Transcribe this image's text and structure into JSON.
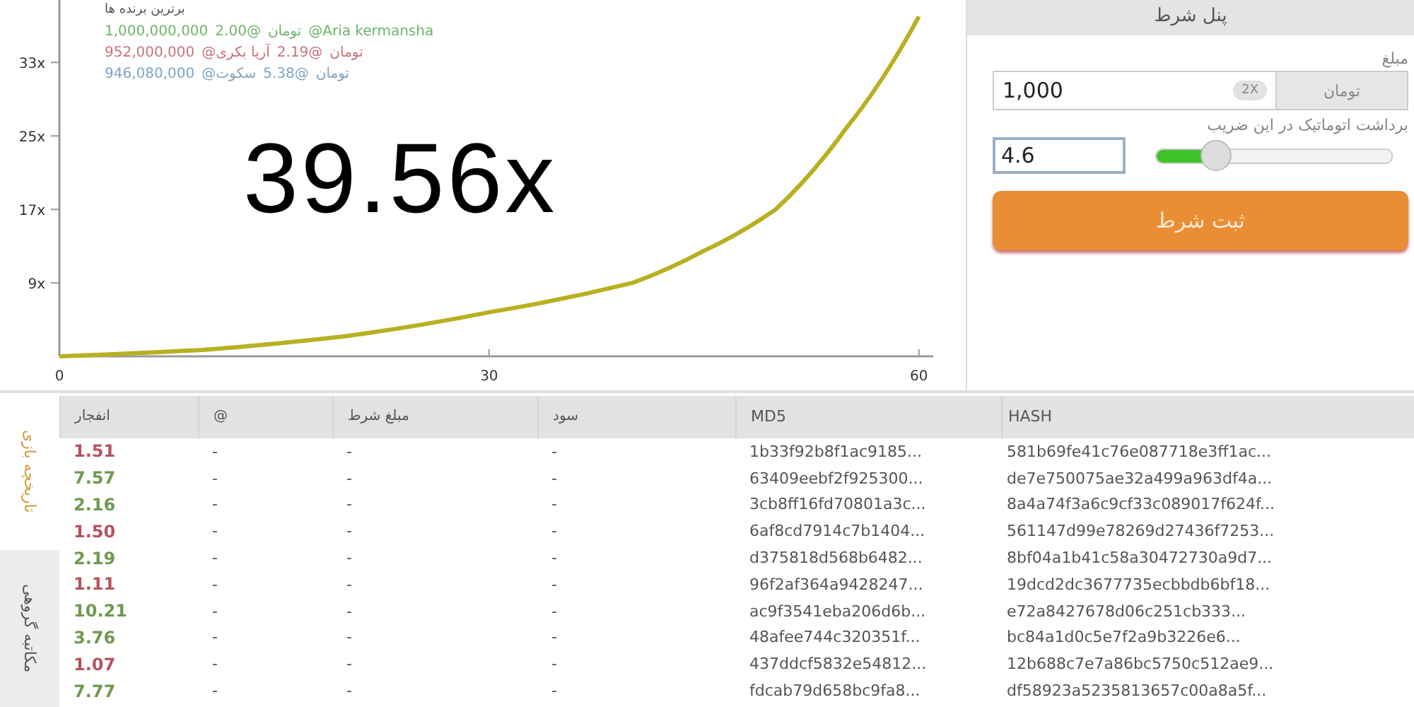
{
  "leaderboard": {
    "title": "برترین برنده ها",
    "rows": [
      {
        "color": "#6fb56a",
        "parts": [
          "1,000,000,000",
          "2.00@",
          "تومان",
          "@Aria kermansha"
        ]
      },
      {
        "color": "#c9727c",
        "parts": [
          "952,000,000",
          "@آریا بکری",
          "2.19@",
          "تومان"
        ]
      },
      {
        "color": "#7ea4c4",
        "parts": [
          "946,080,000",
          "@سکوت",
          "5.38@",
          "تومان"
        ]
      }
    ]
  },
  "multiplier": "39.56x",
  "chart": {
    "chart_data": {
      "type": "line",
      "x": [
        0,
        10,
        20,
        30,
        40,
        45,
        50,
        55,
        60
      ],
      "series": [
        {
          "color": "#b8b020",
          "values": [
            1,
            1.7,
            3.2,
            5.8,
            9,
            12.5,
            17,
            26,
            38
          ]
        }
      ],
      "xlim": [
        0,
        61
      ],
      "ylim": [
        1,
        39.8
      ],
      "xticks": [
        0,
        30,
        60
      ],
      "yticks": [
        {
          "value": 9,
          "label": "9x"
        },
        {
          "value": 17,
          "label": "17x"
        },
        {
          "value": 25,
          "label": "25x"
        },
        {
          "value": 33,
          "label": "33x"
        }
      ]
    }
  },
  "panel": {
    "title": "پنل شرط",
    "amount_label": "مبلغ",
    "amount_value": "1,000",
    "double_button": "2X",
    "currency": "تومان",
    "auto_label": "برداشت اتوماتیک در این ضریب",
    "auto_value": "4.6",
    "auto_level": {
      "level": 0.25
    },
    "submit": "ثبت شرط"
  },
  "side_tabs": [
    {
      "label": "تاریخچه بازی",
      "selected": true
    },
    {
      "label": "مکاتبه گروهی",
      "selected": false
    }
  ],
  "table": {
    "columns": [
      "انفجار",
      "@",
      "مبلغ شرط",
      "سود",
      "MD5",
      "HASH"
    ],
    "rows": [
      {
        "crash": "1.51",
        "color": "#b5525e",
        "at": "-",
        "bet": "-",
        "profit": "-",
        "md5": "1b33f92b8f1ac9185...",
        "hash": "581b69fe41c76e087718e3ff1ac..."
      },
      {
        "crash": "7.57",
        "color": "#6f9a4e",
        "at": "-",
        "bet": "-",
        "profit": "-",
        "md5": "63409eebf2f925300...",
        "hash": "de7e750075ae32a499a963df4a..."
      },
      {
        "crash": "2.16",
        "color": "#6f9a4e",
        "at": "-",
        "bet": "-",
        "profit": "-",
        "md5": "3cb8ff16fd70801a3c...",
        "hash": "8a4a74f3a6c9cf33c089017f624f..."
      },
      {
        "crash": "1.50",
        "color": "#b5525e",
        "at": "-",
        "bet": "-",
        "profit": "-",
        "md5": "6af8cd7914c7b1404...",
        "hash": "561147d99e78269d27436f7253..."
      },
      {
        "crash": "2.19",
        "color": "#6f9a4e",
        "at": "-",
        "bet": "-",
        "profit": "-",
        "md5": "d375818d568b6482...",
        "hash": "8bf04a1b41c58a30472730a9d7..."
      },
      {
        "crash": "1.11",
        "color": "#b5525e",
        "at": "-",
        "bet": "-",
        "profit": "-",
        "md5": "96f2af364a9428247...",
        "hash": "19dcd2dc3677735ecbbdb6bf18..."
      },
      {
        "crash": "10.21",
        "color": "#6f9a4e",
        "at": "-",
        "bet": "-",
        "profit": "-",
        "md5": "ac9f3541eba206d6b...",
        "hash": "e72a8427678d06c251cb333..."
      },
      {
        "crash": "3.76",
        "color": "#6f9a4e",
        "at": "-",
        "bet": "-",
        "profit": "-",
        "md5": "48afee744c320351f...",
        "hash": "bc84a1d0c5e7f2a9b3226e6..."
      },
      {
        "crash": "1.07",
        "color": "#b5525e",
        "at": "-",
        "bet": "-",
        "profit": "-",
        "md5": "437ddcf5832e54812...",
        "hash": "12b688c7e7a86bc5750c512ae9..."
      },
      {
        "crash": "7.77",
        "color": "#6f9a4e",
        "at": "-",
        "bet": "-",
        "profit": "-",
        "md5": "fdcab79d658bc9fa8...",
        "hash": "df58923a5235813657c00a8a5f..."
      }
    ]
  }
}
